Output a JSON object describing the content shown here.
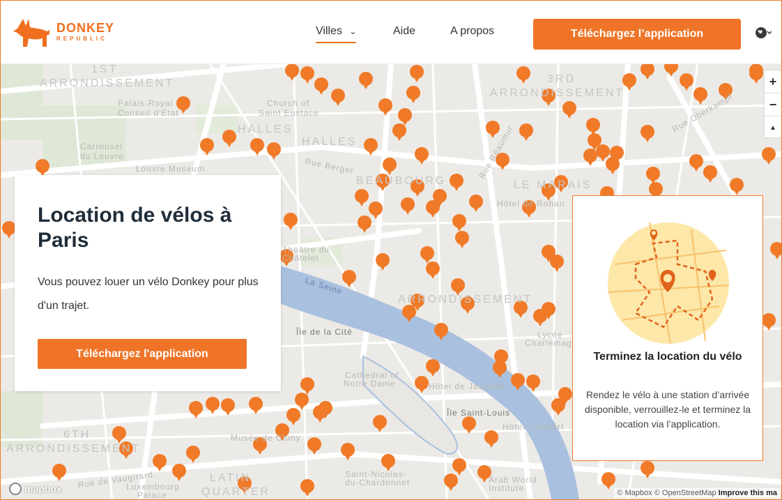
{
  "brand": {
    "name": "DONKEY",
    "sub": "REPUBLIC",
    "color": "#EF6F1F"
  },
  "nav": {
    "items": [
      {
        "label": "Villes",
        "active": true,
        "has_dropdown": true
      },
      {
        "label": "Aide"
      },
      {
        "label": "A propos"
      }
    ],
    "cta_label": "Téléchargez l’application",
    "lang_icon": "globe-icon"
  },
  "map": {
    "labels": [
      "1ST",
      "ARRONDISSEMENT",
      "Palais-Royal",
      "Conseil d'Etat",
      "Church of",
      "Saint Eustace",
      "HALLES",
      "HALLES",
      "Carrousel",
      "du Louvre",
      "Louvre Museum",
      "Rue Berger",
      "BEAUBOURG",
      "3RD",
      "ARRONDISSEMENT",
      "LE MARAIS",
      "Hôtel de Rohan",
      "Théâtre du",
      "Châtelet",
      "La Seine",
      "ARRONDISSEMENT",
      "Île de la Cité",
      "Lycée",
      "Charlemagne",
      "Cathedral of",
      "Notre Dame",
      "Hôtel de Jassaud",
      "Île Saint-Louis",
      "Hôtel Lambert",
      "6TH",
      "ARRONDISSEMENT",
      "Musée de Cluny",
      "Rue de Vaugirard",
      "Luxembourg",
      "Palace",
      "LATIN",
      "QUARTER",
      "Saint-Nicolas-",
      "du-Chardonnet",
      "Arab World",
      "Institute",
      "Rue Réaumur",
      "Rue Oberkampf"
    ],
    "zoom_in": "+",
    "zoom_out": "−",
    "compass": "▲",
    "mapbox_logo": "mapbox",
    "attribution_prefix": "© Mapbox © OpenStreetMap",
    "attribution_link": "Improve this ma",
    "marker_color": "#F07A28"
  },
  "hero": {
    "title": "Location de vélos à Paris",
    "body": "Vous pouvez louer un vélo Donkey pour plus d'un trajet.",
    "button": "Téléchargez l'application"
  },
  "info_card": {
    "title": "Terminez la location du vélo",
    "body": "Rendez le vélo à une station d’arrivée disponible, verrouillez-le et terminez la location via l’application.",
    "illustration": "route-map-icon"
  }
}
